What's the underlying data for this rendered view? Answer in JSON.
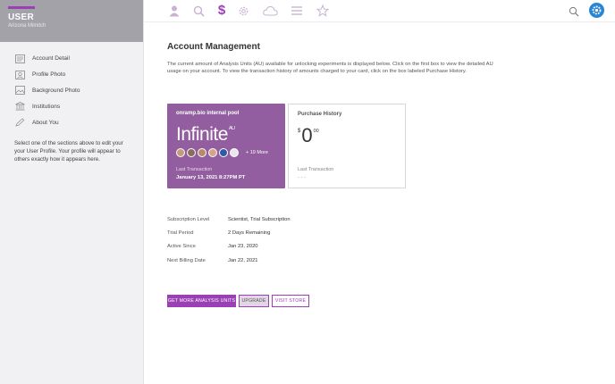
{
  "sidebar": {
    "user_title": "USER",
    "user_name": "Arizona Milnitch",
    "items": [
      {
        "label": "Account Detail",
        "icon": "account-detail-icon"
      },
      {
        "label": "Profile Photo",
        "icon": "profile-photo-icon"
      },
      {
        "label": "Background Photo",
        "icon": "background-photo-icon"
      },
      {
        "label": "Institutions",
        "icon": "institution-icon"
      },
      {
        "label": "About You",
        "icon": "pencil-icon"
      }
    ],
    "hint": "Select one of the sections above to edit your your User Profile. Your profile will appear to others exactly how it appears here."
  },
  "topbar": {
    "icons": [
      "user-icon",
      "search-icon",
      "dollar-icon",
      "gear-icon",
      "cloud-icon",
      "list-icon",
      "star-icon"
    ],
    "dollar_symbol": "$",
    "active_color": "#9b3fb5",
    "inactive_color": "#c9b3d2"
  },
  "main": {
    "title": "Account Management",
    "description": "The current amount of Analysis Units (AU) available for unlocking experiments is displayed below. Click on the first box to view the detailed AU usage on your account. To view the transaction history of amounts charged to your card, click on the box labeled Purchase History.",
    "au_card": {
      "pool_name": "onramp.bio internal pool",
      "amount": "Infinite",
      "unit": "AU",
      "more_label": "+ 19 More",
      "last_transaction_label": "Last Transaction",
      "last_transaction_value": "January 13, 2021 8:27PM PT",
      "color": "#925e9f"
    },
    "purchase_card": {
      "title": "Purchase History",
      "currency": "$",
      "whole": "0",
      "cents": "00",
      "last_transaction_label": "Last Transaction",
      "last_transaction_value": "- - -"
    },
    "details": [
      {
        "label": "Subscription Level",
        "value": "Scientist, Trial Subscription"
      },
      {
        "label": "Trial Period",
        "value": "2 Days Remaining"
      },
      {
        "label": "Active Since",
        "value": "Jan 23, 2020"
      },
      {
        "label": "Next Billing Date",
        "value": "Jan 22, 2021"
      }
    ],
    "buttons": {
      "get_more": "GET MORE ANALYSIS UNITS",
      "upgrade": "UPGRADE",
      "visit_store": "VISIT STORE"
    }
  }
}
